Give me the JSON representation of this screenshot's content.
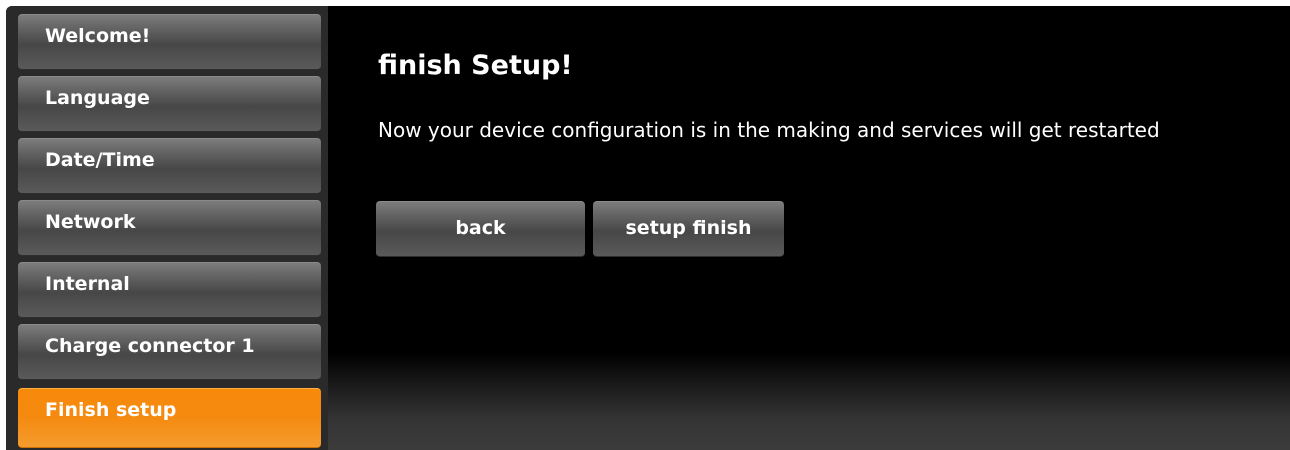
{
  "sidebar": {
    "items": [
      {
        "label": "Welcome!",
        "active": false
      },
      {
        "label": "Language",
        "active": false
      },
      {
        "label": "Date/Time",
        "active": false
      },
      {
        "label": "Network",
        "active": false
      },
      {
        "label": "Internal",
        "active": false
      },
      {
        "label": "Charge connector 1",
        "active": false
      },
      {
        "label": "Finish setup",
        "active": true
      }
    ]
  },
  "main": {
    "title": "finish Setup!",
    "message": "Now your device configuration is in the making and services will get restarted",
    "buttons": {
      "back_label": "back",
      "finish_label": "setup finish"
    }
  },
  "colors": {
    "accent": "#f68b0f",
    "background": "#000000",
    "button": "#5e5e5e"
  }
}
